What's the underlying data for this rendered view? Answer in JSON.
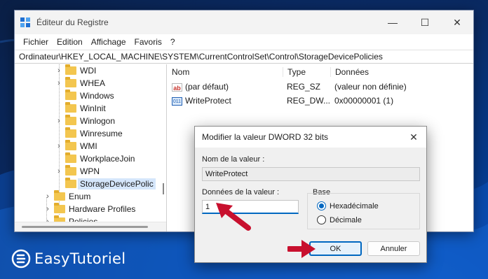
{
  "window": {
    "title": "Éditeur du Registre",
    "controls": {
      "minimize": "—",
      "maximize": "☐",
      "close": "✕"
    }
  },
  "menu": {
    "items": [
      "Fichier",
      "Edition",
      "Affichage",
      "Favoris",
      "?"
    ]
  },
  "address": "Ordinateur\\HKEY_LOCAL_MACHINE\\SYSTEM\\CurrentControlSet\\Control\\StorageDevicePolicies",
  "tree": {
    "items": [
      {
        "label": "WDI",
        "expandable": true
      },
      {
        "label": "WHEA",
        "expandable": true
      },
      {
        "label": "Windows",
        "expandable": false
      },
      {
        "label": "WinInit",
        "expandable": false
      },
      {
        "label": "Winlogon",
        "expandable": true
      },
      {
        "label": "Winresume",
        "expandable": false
      },
      {
        "label": "WMI",
        "expandable": true
      },
      {
        "label": "WorkplaceJoin",
        "expandable": false
      },
      {
        "label": "WPN",
        "expandable": true
      },
      {
        "label": "StorageDevicePolic",
        "expandable": false,
        "selected": true
      },
      {
        "label": "Enum",
        "expandable": true
      },
      {
        "label": "Hardware Profiles",
        "expandable": true
      },
      {
        "label": "Policies",
        "expandable": true
      }
    ]
  },
  "list": {
    "headers": {
      "name": "Nom",
      "type": "Type",
      "data": "Données"
    },
    "rows": [
      {
        "icon": "string-value-icon",
        "name": "(par défaut)",
        "type": "REG_SZ",
        "data": "(valeur non définie)"
      },
      {
        "icon": "dword-value-icon",
        "name": "WriteProtect",
        "type": "REG_DW...",
        "data": "0x00000001 (1)"
      }
    ]
  },
  "dialog": {
    "title": "Modifier la valeur DWORD 32 bits",
    "close": "✕",
    "value_name_label": "Nom de la valeur :",
    "value_name": "WriteProtect",
    "value_data_label": "Données de la valeur :",
    "value_data": "1",
    "base_label": "Base",
    "base_options": [
      {
        "label": "Hexadécimale",
        "checked": true
      },
      {
        "label": "Décimale",
        "checked": false
      }
    ],
    "ok_label": "OK",
    "cancel_label": "Annuler"
  },
  "annotation_color": "#c8102e",
  "accent_color": "#0067c0",
  "brand": {
    "name": "EasyTutoriel"
  }
}
